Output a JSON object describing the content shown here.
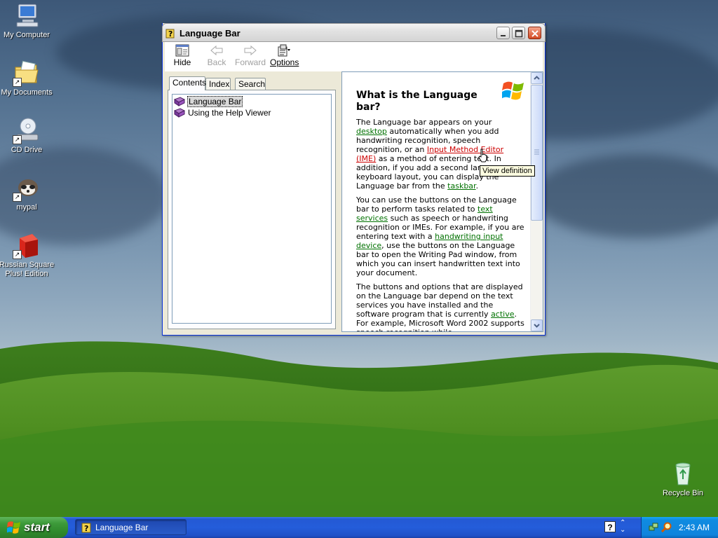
{
  "desktop": {
    "icons": [
      {
        "label": "My Computer",
        "icon": "computer-icon"
      },
      {
        "label": "My Documents",
        "icon": "documents-folder-icon"
      },
      {
        "label": "CD Drive",
        "icon": "cd-drive-icon"
      },
      {
        "label": "mypal",
        "icon": "mypal-browser-icon"
      },
      {
        "label_line1": "Russian Square",
        "label_line2": "Plus! Edition",
        "icon": "russian-square-icon"
      },
      {
        "label": "Recycle Bin",
        "icon": "recycle-bin-icon"
      }
    ]
  },
  "window": {
    "title": "Language Bar",
    "toolbar": {
      "hide": "Hide",
      "back": "Back",
      "forward": "Forward",
      "options": "Options"
    },
    "tabs": [
      "Contents",
      "Index",
      "Search"
    ],
    "tree": [
      "Language Bar",
      "Using the Help Viewer"
    ],
    "article": {
      "heading": "What is the Language bar?",
      "p1": {
        "t1": "The Language bar appears on your ",
        "link_desktop": "desktop",
        "t2": " automatically when you add handwriting recognition, speech recognition, or an ",
        "link_ime": "Input Method Editor (IME)",
        "t3": " as a method of entering text. In addition, if you add a second language or keyboard layout, you can display the Language bar from the ",
        "link_taskbar": "taskbar",
        "t4": "."
      },
      "p2": {
        "t1": "You can use the buttons on the Language bar to perform tasks related to ",
        "link_text_services": "text services",
        "t2": " such as speech or handwriting recognition or IMEs. For example, if you are entering text with a ",
        "link_handwriting": "handwriting input device",
        "t3": ", use the buttons on the Language bar to open the Writing Pad window, from which you can insert handwritten text into your document."
      },
      "p3": {
        "t1": "The buttons and options that are displayed on the Language bar depend on the text services you have installed and the software program that is currently ",
        "link_active": "active",
        "t2": ". For example, Microsoft Word 2002 supports speech recognition while"
      }
    },
    "tooltip": "View definition"
  },
  "taskbar": {
    "start_label": "start",
    "task_button": "Language Bar",
    "clock": "2:43 AM"
  }
}
